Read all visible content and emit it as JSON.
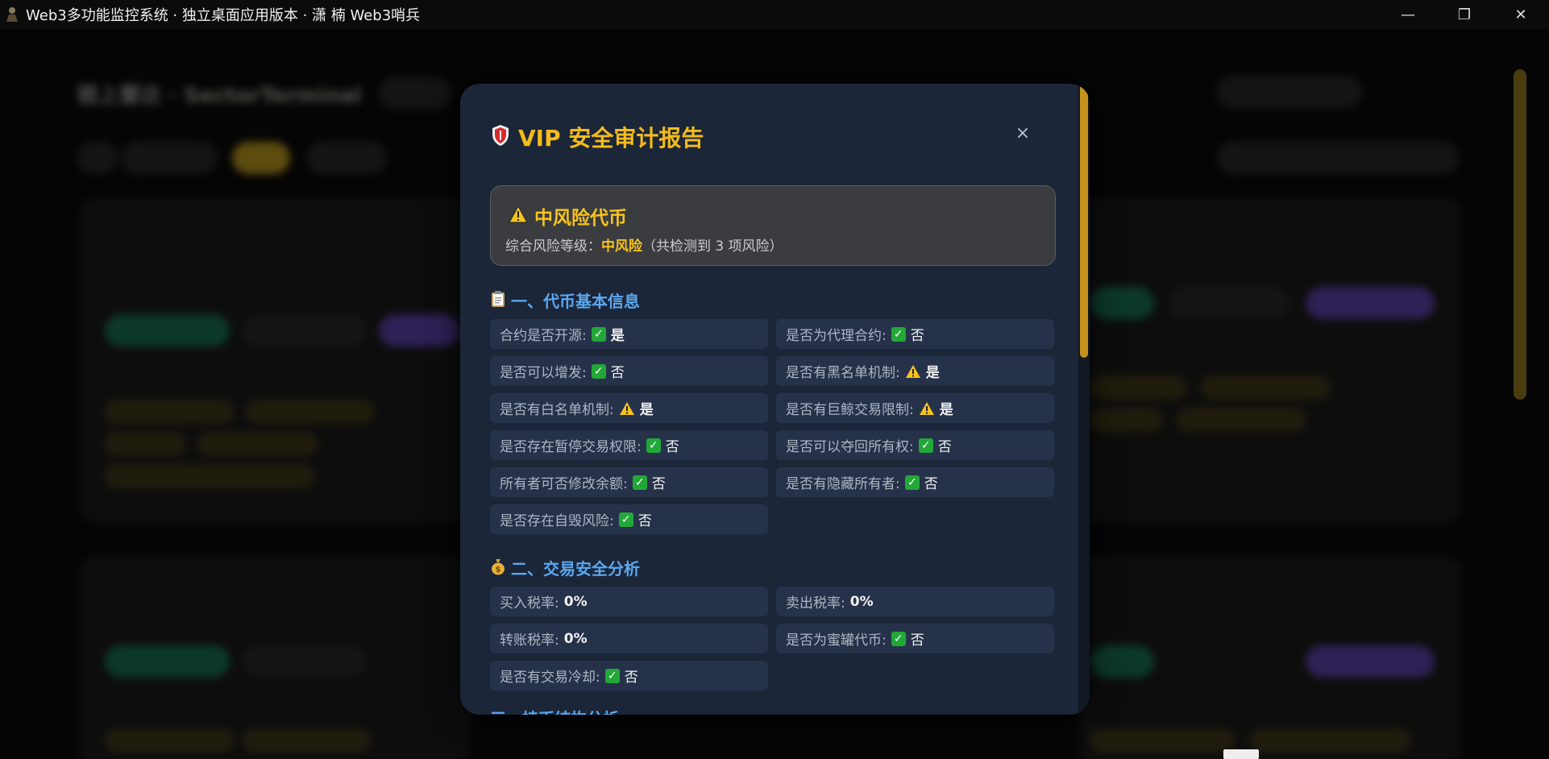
{
  "window": {
    "title": "Web3多功能监控系统 · 独立桌面应用版本 · 潇 楠 Web3哨兵",
    "minimize": "—",
    "restore": "❐",
    "close": "✕"
  },
  "background": {
    "app_title": "链上雷达 · SectorTerminal"
  },
  "modal": {
    "title": "VIP 安全审计报告",
    "close_label": "×",
    "risk": {
      "title": "中风险代币",
      "summary_prefix": "综合风险等级：",
      "level": "中风险",
      "summary_suffix": "（共检测到 3 项风险）"
    },
    "sections": [
      {
        "title": "一、代币基本信息",
        "icon": "clipboard-icon",
        "items": [
          {
            "label": "合约是否开源:",
            "status": "check",
            "value": "是"
          },
          {
            "label": "是否为代理合约:",
            "status": "check",
            "value": "否"
          },
          {
            "label": "是否可以增发:",
            "status": "check",
            "value": "否"
          },
          {
            "label": "是否有黑名单机制:",
            "status": "warn",
            "value": "是"
          },
          {
            "label": "是否有白名单机制:",
            "status": "warn",
            "value": "是"
          },
          {
            "label": "是否有巨鲸交易限制:",
            "status": "warn",
            "value": "是"
          },
          {
            "label": "是否存在暂停交易权限:",
            "status": "check",
            "value": "否"
          },
          {
            "label": "是否可以夺回所有权:",
            "status": "check",
            "value": "否"
          },
          {
            "label": "所有者可否修改余额:",
            "status": "check",
            "value": "否"
          },
          {
            "label": "是否有隐藏所有者:",
            "status": "check",
            "value": "否"
          },
          {
            "label": "是否存在自毁风险:",
            "status": "check",
            "value": "否"
          }
        ]
      },
      {
        "title": "二、交易安全分析",
        "icon": "money-bag-icon",
        "items": [
          {
            "label": "买入税率:",
            "status": "none",
            "value": "0%"
          },
          {
            "label": "卖出税率:",
            "status": "none",
            "value": "0%"
          },
          {
            "label": "转账税率:",
            "status": "none",
            "value": "0%"
          },
          {
            "label": "是否为蜜罐代币:",
            "status": "check",
            "value": "否"
          },
          {
            "label": "是否有交易冷却:",
            "status": "check",
            "value": "否"
          }
        ]
      }
    ],
    "next_section_peek": "三、持币结构分析"
  },
  "colors": {
    "accent_gold": "#f3bb1c",
    "section_blue": "#5aa8f0",
    "check_green": "#22a838",
    "modal_bg": "#1c2639"
  }
}
